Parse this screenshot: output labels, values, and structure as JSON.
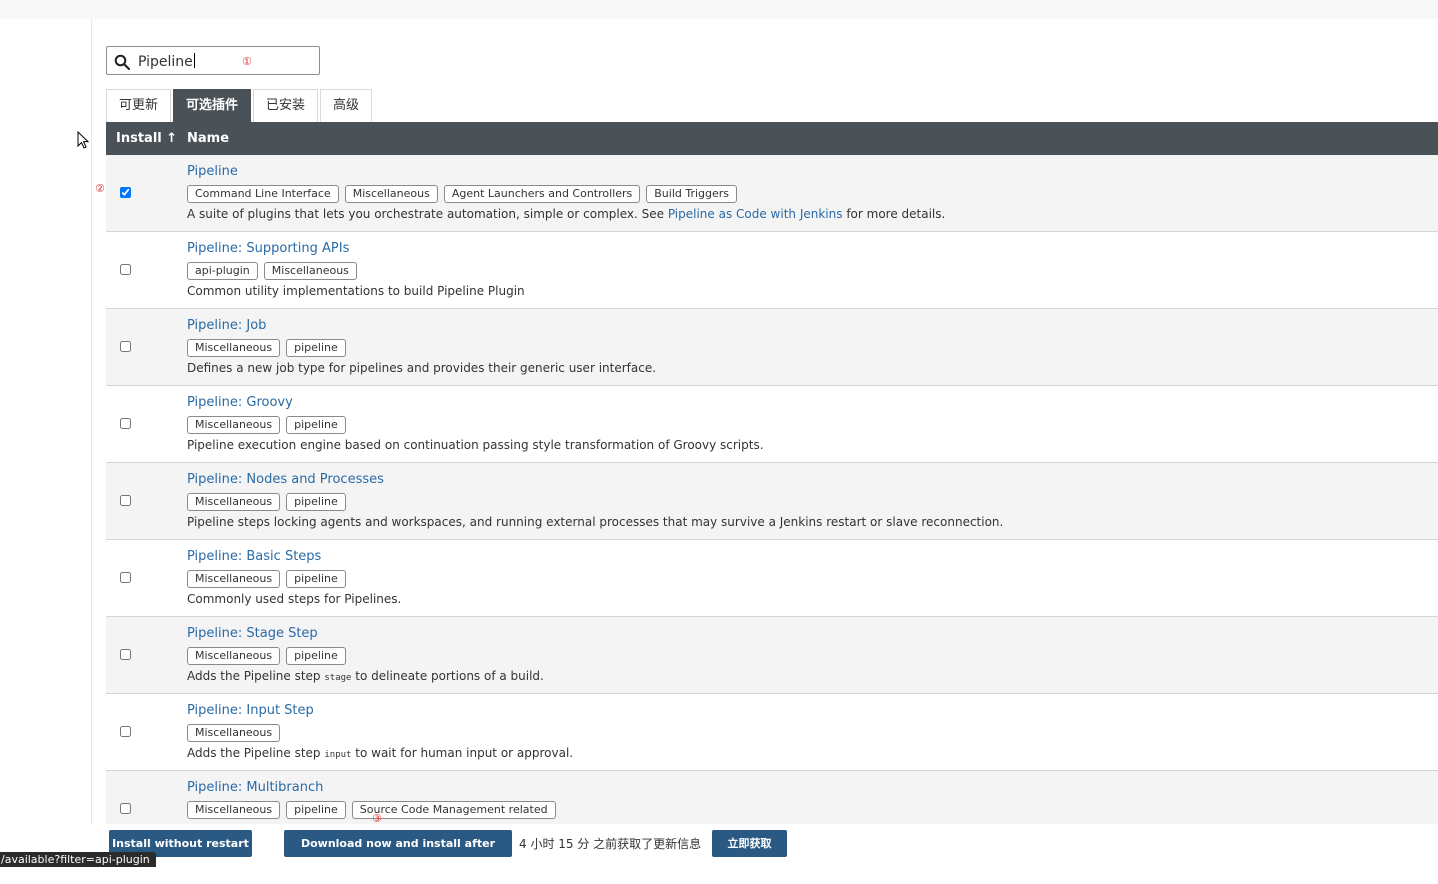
{
  "search": {
    "value": "Pipeline"
  },
  "annotations": {
    "one": "①",
    "two": "②",
    "three": "③"
  },
  "tabs": [
    {
      "label": "可更新",
      "active": false
    },
    {
      "label": "可选插件",
      "active": true
    },
    {
      "label": "已安装",
      "active": false
    },
    {
      "label": "高级",
      "active": false
    }
  ],
  "table": {
    "col_install": "Install ↑",
    "col_name": "Name",
    "rows": [
      {
        "name": "Pipeline",
        "checked": true,
        "tags": [
          "Command Line Interface",
          "Miscellaneous",
          "Agent Launchers and Controllers",
          "Build Triggers"
        ],
        "desc_before": "A suite of plugins that lets you orchestrate automation, simple or complex. See ",
        "desc_link": "Pipeline as Code with Jenkins",
        "desc_after": " for more details."
      },
      {
        "name": "Pipeline: Supporting APIs",
        "checked": false,
        "tags": [
          "api-plugin",
          "Miscellaneous"
        ],
        "desc": "Common utility implementations to build Pipeline Plugin"
      },
      {
        "name": "Pipeline: Job",
        "checked": false,
        "tags": [
          "Miscellaneous",
          "pipeline"
        ],
        "desc": "Defines a new job type for pipelines and provides their generic user interface."
      },
      {
        "name": "Pipeline: Groovy",
        "checked": false,
        "tags": [
          "Miscellaneous",
          "pipeline"
        ],
        "desc": "Pipeline execution engine based on continuation passing style transformation of Groovy scripts."
      },
      {
        "name": "Pipeline: Nodes and Processes",
        "checked": false,
        "tags": [
          "Miscellaneous",
          "pipeline"
        ],
        "desc": "Pipeline steps locking agents and workspaces, and running external processes that may survive a Jenkins restart or slave reconnection."
      },
      {
        "name": "Pipeline: Basic Steps",
        "checked": false,
        "tags": [
          "Miscellaneous",
          "pipeline"
        ],
        "desc": "Commonly used steps for Pipelines."
      },
      {
        "name": "Pipeline: Stage Step",
        "checked": false,
        "tags": [
          "Miscellaneous",
          "pipeline"
        ],
        "desc_before": "Adds the Pipeline step ",
        "desc_code": "stage",
        "desc_after": " to delineate portions of a build."
      },
      {
        "name": "Pipeline: Input Step",
        "checked": false,
        "tags": [
          "Miscellaneous"
        ],
        "desc_before": "Adds the Pipeline step ",
        "desc_code": "input",
        "desc_after": " to wait for human input or approval."
      },
      {
        "name": "Pipeline: Multibranch",
        "checked": false,
        "tags": [
          "Miscellaneous",
          "pipeline",
          "Source Code Management related"
        ],
        "desc": ""
      }
    ]
  },
  "bottom": {
    "install_without_restart": "Install without restart",
    "download_install_after_restart": "Download now and install after restart",
    "updated_info": "4 小时 15 分 之前获取了更新信息",
    "fetch_now": "立即获取"
  },
  "status_url": "/available?filter=api-plugin",
  "colors": {
    "header_bg": "#4a5157",
    "link": "#2a6aa6",
    "button": "#2a5a83",
    "annotation": "#e03434"
  }
}
